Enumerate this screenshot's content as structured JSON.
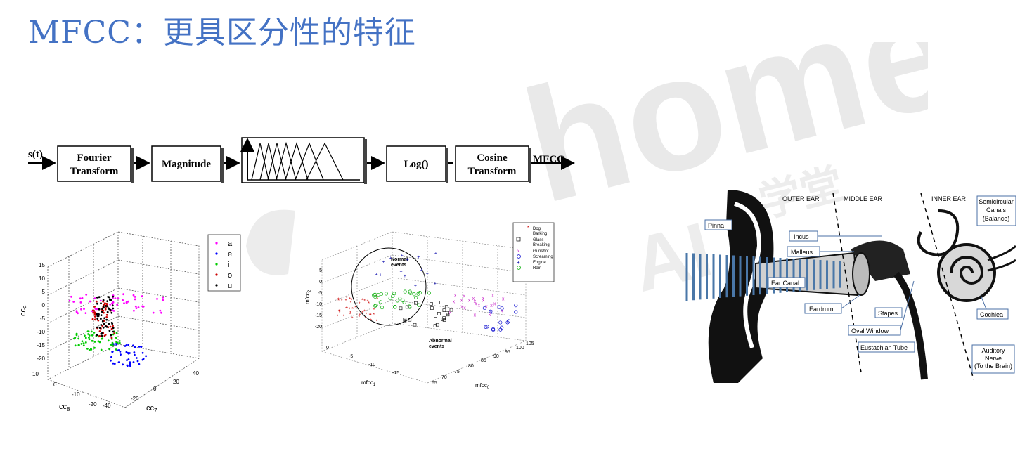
{
  "slide": {
    "title": "MFCC：更具区分性的特征"
  },
  "watermark": {
    "main": "home",
    "sub": "AI",
    "cn": "学堂"
  },
  "flow": {
    "input": "s(t)",
    "blocks": [
      "Fourier",
      "Transform",
      "Magnitude",
      "Log()",
      "Cosine",
      "Transform"
    ],
    "output": "MFCC"
  },
  "vowel_plot": {
    "legend": [
      "a",
      "e",
      "i",
      "o",
      "u"
    ],
    "colors": [
      "#ff00ff",
      "#0000ff",
      "#00cc00",
      "#cc0000",
      "#000000"
    ],
    "zlabel": "cc",
    "zsub": "9",
    "xlabel": "cc",
    "xsub": "8",
    "ylabel": "cc",
    "ysub": "7",
    "zticks": [
      "15",
      "10",
      "5",
      "0",
      "-5",
      "-10",
      "-15",
      "-20"
    ],
    "xticks": [
      "10",
      "0",
      "-10",
      "-20"
    ],
    "yticks": [
      "-40",
      "-20",
      "0",
      "20",
      "40"
    ]
  },
  "event_plot": {
    "legend": [
      "Dog",
      "Barking",
      "Glass",
      "Breaking",
      "Gunshot",
      "Screaming",
      "Engine",
      "Rain"
    ],
    "normal_label": [
      "Normal",
      "events"
    ],
    "abnormal_label": [
      "Abnormal",
      "events"
    ],
    "zlabel": "mfcc",
    "zsub": "2",
    "xlabel": "mfcc",
    "xsub": "1",
    "ylabel": "mfcc",
    "ysub": "0",
    "zticks": [
      "5",
      "0",
      "-5",
      "-10",
      "-15",
      "-20"
    ],
    "xticks": [
      "0",
      "-5",
      "-10",
      "-15"
    ],
    "yticks": [
      "65",
      "70",
      "75",
      "80",
      "85",
      "90",
      "95",
      "100",
      "105"
    ]
  },
  "ear_diagram": {
    "regions": [
      "OUTER EAR",
      "MIDDLE EAR",
      "INNER EAR"
    ],
    "labels": [
      "Pinna",
      "Incus",
      "Malleus",
      "Ear Canal",
      "Eardrum",
      "Stapes",
      "Oval Window",
      "Eustachian Tube",
      "Semicircular",
      "Canals",
      "(Balance)",
      "Cochlea",
      "Auditory",
      "Nerve",
      "(To the Brain)"
    ]
  }
}
